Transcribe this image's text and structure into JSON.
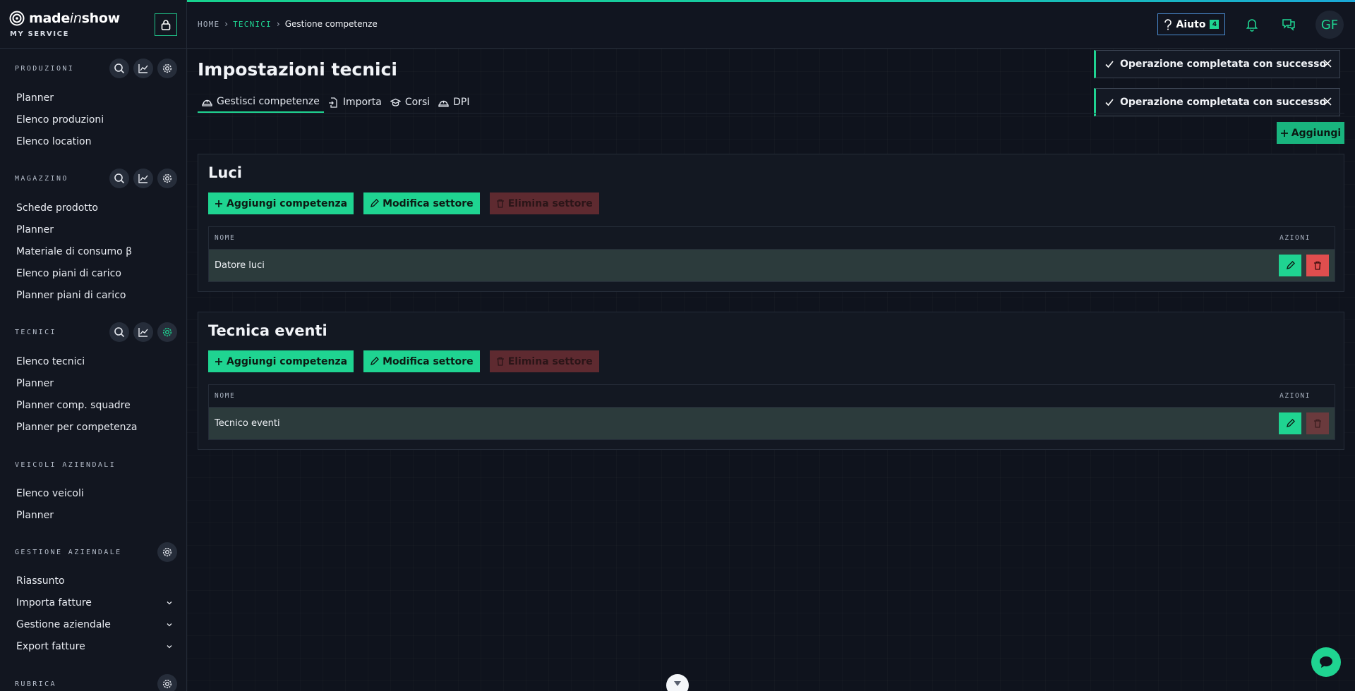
{
  "brand": {
    "name_prefix": "made",
    "name_italic": "in",
    "name_suffix": "show",
    "subtitle": "MY SERVICE"
  },
  "sidebar": {
    "sections": [
      {
        "title": "PRODUZIONI",
        "items": [
          "Planner",
          "Elenco produzioni",
          "Elenco location"
        ]
      },
      {
        "title": "MAGAZZINO",
        "items": [
          "Schede prodotto",
          "Planner",
          "Materiale di consumo β",
          "Elenco piani di carico",
          "Planner piani di carico"
        ]
      },
      {
        "title": "TECNICI",
        "items": [
          "Elenco tecnici",
          "Planner",
          "Planner comp. squadre",
          "Planner per competenza"
        ]
      },
      {
        "title": "VEICOLI AZIENDALI",
        "items": [
          "Elenco veicoli",
          "Planner"
        ]
      },
      {
        "title": "GESTIONE AZIENDALE",
        "items": [
          "Riassunto",
          "Importa fatture",
          "Gestione aziendale",
          "Export fatture"
        ]
      },
      {
        "title": "RUBRICA",
        "items": []
      }
    ]
  },
  "breadcrumb": {
    "home": "HOME",
    "section": "TECNICI",
    "current": "Gestione competenze"
  },
  "header": {
    "help_label": "Aiuto",
    "help_count": "4",
    "avatar_initials": "GF"
  },
  "page": {
    "title": "Impostazioni tecnici",
    "tabs": [
      "Gestisci competenze",
      "Importa",
      "Corsi",
      "DPI"
    ],
    "add_label": "Aggiungi"
  },
  "buttons": {
    "add_skill": "Aggiungi competenza",
    "edit_sector": "Modifica settore",
    "delete_sector": "Elimina settore"
  },
  "table_headers": {
    "name": "NOME",
    "actions": "AZIONI"
  },
  "sectors": [
    {
      "title": "Luci",
      "rows": [
        "Datore luci"
      ]
    },
    {
      "title": "Tecnica eventi",
      "rows": [
        "Tecnico eventi"
      ]
    }
  ],
  "toasts": [
    "Operazione completata con successo",
    "Operazione completata con successo"
  ],
  "colors": {
    "accent": "#1fd491",
    "danger": "#e04e4e",
    "background": "#0f131d"
  }
}
